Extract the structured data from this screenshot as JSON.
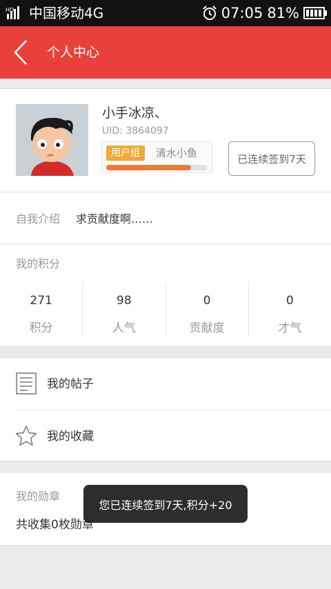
{
  "status_bar": {
    "carrier": "中国移动4G",
    "time": "07:05",
    "battery": "81%"
  },
  "header": {
    "title": "个人中心",
    "background": "#e8413c"
  },
  "profile": {
    "username": "小手冰凉、",
    "uid": "UID: 3864097",
    "group_badge": "用户组",
    "group_name": "清水小鱼",
    "progress_fraction": 0.84,
    "signin_label": "已连续签到7天",
    "intro_label": "自我介绍",
    "intro_text": "求贡献度啊……"
  },
  "scores": {
    "title": "我的积分",
    "items": [
      {
        "value": "271",
        "label": "积分"
      },
      {
        "value": "98",
        "label": "人气"
      },
      {
        "value": "0",
        "label": "贡献度"
      },
      {
        "value": "0",
        "label": "才气"
      }
    ]
  },
  "menu": {
    "posts_label": "我的帖子",
    "posts_icon": "document-icon",
    "favorites_label": "我的收藏",
    "favorites_icon": "star-icon"
  },
  "medals": {
    "title": "我的勋章",
    "count_text": "共收集0枚勋章"
  },
  "toast": {
    "message": "您已连续签到7天,积分+20"
  }
}
